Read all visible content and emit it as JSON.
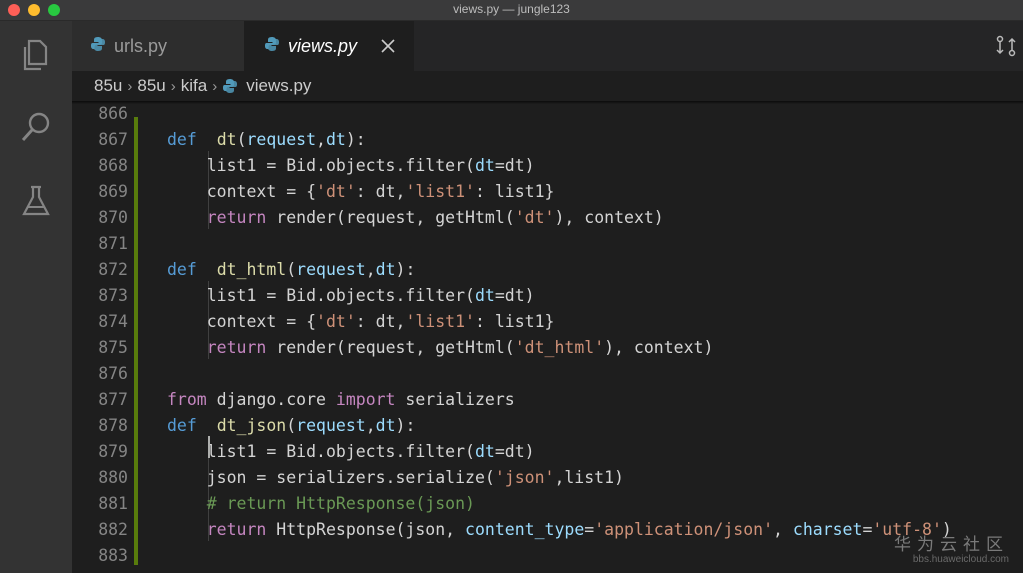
{
  "window": {
    "title": "views.py — jungle123"
  },
  "activity_bar": [
    "files-icon",
    "search-icon",
    "flask-icon"
  ],
  "tabs": [
    {
      "label": "urls.py",
      "icon": "python-icon",
      "active": false
    },
    {
      "label": "views.py",
      "icon": "python-icon",
      "active": true
    }
  ],
  "breadcrumb": [
    "85u",
    "85u",
    "kifa",
    "views.py"
  ],
  "editor": {
    "lines": [
      {
        "n": "866",
        "tokens": []
      },
      {
        "n": "867",
        "tokens": [
          [
            "kw",
            "def"
          ],
          [
            "",
            "  "
          ],
          [
            "fn",
            "dt"
          ],
          [
            "",
            "("
          ],
          [
            "prm",
            "request"
          ],
          [
            "",
            ","
          ],
          [
            "prm",
            "dt"
          ],
          [
            "",
            "):"
          ]
        ]
      },
      {
        "n": "868",
        "tokens": [
          [
            "",
            "    list1 = Bid.objects.filter("
          ],
          [
            "prm",
            "dt"
          ],
          [
            "",
            "=dt)"
          ]
        ]
      },
      {
        "n": "869",
        "tokens": [
          [
            "",
            "    context = {"
          ],
          [
            "str",
            "'dt'"
          ],
          [
            "",
            ": dt,"
          ],
          [
            "str",
            "'list1'"
          ],
          [
            "",
            ": list1}"
          ]
        ]
      },
      {
        "n": "870",
        "tokens": [
          [
            "",
            "    "
          ],
          [
            "ctl",
            "return"
          ],
          [
            "",
            " render(request, getHtml("
          ],
          [
            "str",
            "'dt'"
          ],
          [
            "",
            "), context)"
          ]
        ]
      },
      {
        "n": "871",
        "tokens": []
      },
      {
        "n": "872",
        "tokens": [
          [
            "kw",
            "def"
          ],
          [
            "",
            "  "
          ],
          [
            "fn",
            "dt_html"
          ],
          [
            "",
            "("
          ],
          [
            "prm",
            "request"
          ],
          [
            "",
            ","
          ],
          [
            "prm",
            "dt"
          ],
          [
            "",
            "):"
          ]
        ]
      },
      {
        "n": "873",
        "tokens": [
          [
            "",
            "    list1 = Bid.objects.filter("
          ],
          [
            "prm",
            "dt"
          ],
          [
            "",
            "=dt)"
          ]
        ]
      },
      {
        "n": "874",
        "tokens": [
          [
            "",
            "    context = {"
          ],
          [
            "str",
            "'dt'"
          ],
          [
            "",
            ": dt,"
          ],
          [
            "str",
            "'list1'"
          ],
          [
            "",
            ": list1}"
          ]
        ]
      },
      {
        "n": "875",
        "tokens": [
          [
            "",
            "    "
          ],
          [
            "ctl",
            "return"
          ],
          [
            "",
            " render(request, getHtml("
          ],
          [
            "str",
            "'dt_html'"
          ],
          [
            "",
            "), context)"
          ]
        ]
      },
      {
        "n": "876",
        "tokens": []
      },
      {
        "n": "877",
        "tokens": [
          [
            "ctl",
            "from"
          ],
          [
            "",
            " django.core "
          ],
          [
            "ctl",
            "import"
          ],
          [
            "",
            " serializers"
          ]
        ]
      },
      {
        "n": "878",
        "tokens": [
          [
            "kw",
            "def"
          ],
          [
            "",
            "  "
          ],
          [
            "fn",
            "dt_json"
          ],
          [
            "",
            "("
          ],
          [
            "prm",
            "request"
          ],
          [
            "",
            ","
          ],
          [
            "prm",
            "dt"
          ],
          [
            "",
            "):"
          ]
        ]
      },
      {
        "n": "879",
        "tokens": [
          [
            "",
            "    list1 = Bid.objects.filter("
          ],
          [
            "prm",
            "dt"
          ],
          [
            "",
            "=dt)"
          ]
        ]
      },
      {
        "n": "880",
        "tokens": [
          [
            "",
            "    json = serializers.serialize("
          ],
          [
            "str",
            "'json'"
          ],
          [
            "",
            ",list1)"
          ]
        ]
      },
      {
        "n": "881",
        "tokens": [
          [
            "",
            "    "
          ],
          [
            "cmt",
            "# return HttpResponse(json)"
          ]
        ]
      },
      {
        "n": "882",
        "tokens": [
          [
            "",
            "    "
          ],
          [
            "ctl",
            "return"
          ],
          [
            "",
            " HttpResponse(json, "
          ],
          [
            "prm",
            "content_type"
          ],
          [
            "",
            "="
          ],
          [
            "str",
            "'application/json'"
          ],
          [
            "",
            ", "
          ],
          [
            "prm",
            "charset"
          ],
          [
            "",
            "="
          ],
          [
            "str",
            "'utf-8'"
          ],
          [
            "",
            ")"
          ]
        ]
      },
      {
        "n": "883",
        "tokens": []
      }
    ]
  },
  "watermark": {
    "line1": "华为云社区",
    "line2": "bbs.huaweicloud.com"
  }
}
